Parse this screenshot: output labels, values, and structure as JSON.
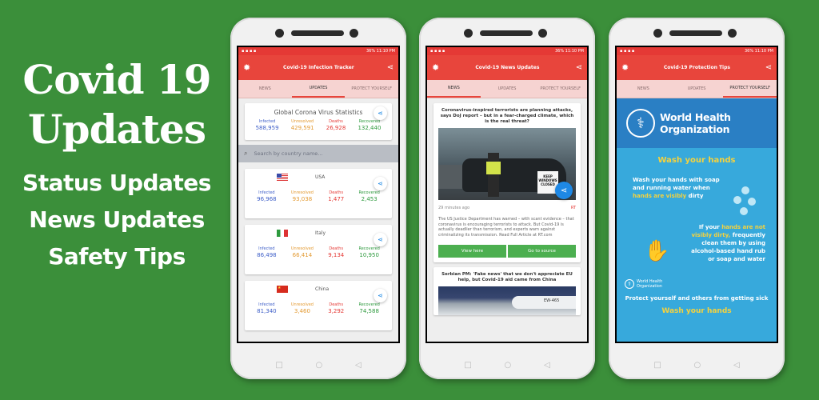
{
  "promo": {
    "title_line1": "Covid 19",
    "title_line2": "Updates",
    "features": [
      "Status Updates",
      "News Updates",
      "Safety Tips"
    ]
  },
  "status_bar": {
    "right": "36% 11:10 PM"
  },
  "screen1": {
    "app_title": "Covid-19 Infection Tracker",
    "tabs": [
      "NEWS",
      "UPDATES",
      "PROTECT YOURSELF"
    ],
    "active_tab": "UPDATES",
    "global": {
      "title": "Global Corona Virus Statistics",
      "labels": [
        "Infected",
        "Unresolved",
        "Deaths",
        "Recovered"
      ],
      "values": [
        "588,959",
        "429,591",
        "26,928",
        "132,440"
      ]
    },
    "search_placeholder": "Search by country name...",
    "countries": [
      {
        "name": "USA",
        "flag": "us-flag",
        "values": [
          "96,968",
          "93,038",
          "1,477",
          "2,453"
        ]
      },
      {
        "name": "Italy",
        "flag": "italy-flag",
        "values": [
          "86,498",
          "66,414",
          "9,134",
          "10,950"
        ]
      },
      {
        "name": "China",
        "flag": "china-flag",
        "values": [
          "81,340",
          "3,460",
          "3,292",
          "74,588"
        ]
      }
    ]
  },
  "screen2": {
    "app_title": "Covid-19 News Updates",
    "tabs": [
      "NEWS",
      "UPDATES",
      "PROTECT YOURSELF"
    ],
    "active_tab": "NEWS",
    "article1": {
      "title": "Coronavirus-inspired terrorists are planning attacks, says DoJ report – but in a fear-charged climate, which is the real threat?",
      "sign_text": "KEEP WINDOWS CLOSED",
      "time": "29 minutes ago",
      "source": "RT",
      "body": "The US Justice Department has warned – with scant evidence – that coronavirus is encouraging terrorists to attack. But Covid-19 is actually deadlier than terrorism, and experts warn against criminalizing its transmission. Read Full Article at RT.com",
      "btn_view": "View here",
      "btn_source": "Go to source"
    },
    "article2": {
      "title": "Serbian PM: 'Fake news' that we don't appreciate EU help, but Covid-19 aid came from China",
      "plane_text": "EW-465"
    }
  },
  "screen3": {
    "app_title": "Covid-19 Protection Tips",
    "tabs": [
      "NEWS",
      "UPDATES",
      "PROTECT YOURSELF"
    ],
    "active_tab": "PROTECT YOURSELF",
    "who_name_line1": "World Health",
    "who_name_line2": "Organization",
    "wash_title": "Wash your hands",
    "wash1_a": "Wash your hands with soap and running water when ",
    "wash1_b": "hands are visibly",
    "wash1_c": " dirty",
    "wash2_a": "If your ",
    "wash2_b": "hands are not visibly dirty,",
    "wash2_c": " frequently clean them by using alcohol-based hand rub or soap and water",
    "who_small": "World Health Organization",
    "protect": "Protect yourself and others from getting sick",
    "protect_wash": "Wash your hands"
  },
  "colors": {
    "background": "#3b8f3a",
    "appbar": "#e8453c",
    "accent": "#1e88e5",
    "button": "#4caf50"
  }
}
